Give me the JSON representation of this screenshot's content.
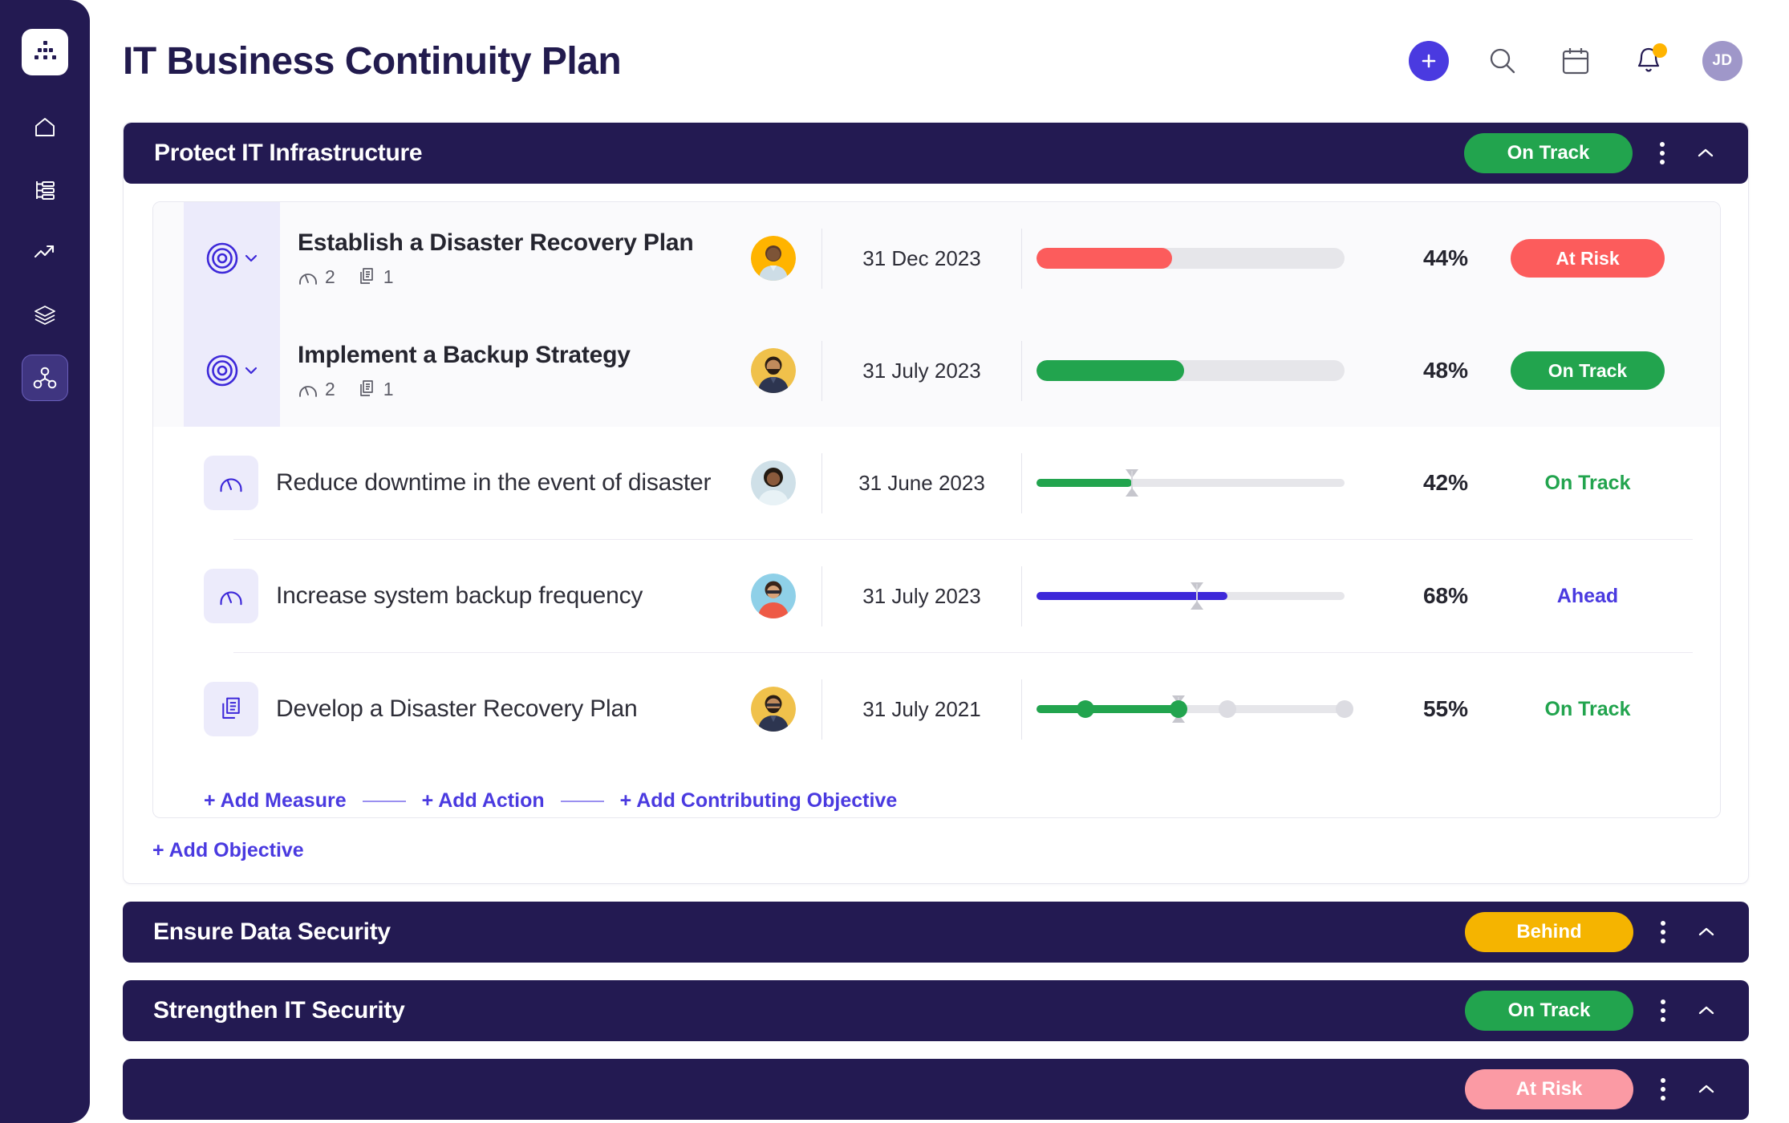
{
  "sidebar": {
    "logo": "org-chart-logo",
    "items": [
      {
        "name": "home",
        "icon": "home-icon",
        "active": false
      },
      {
        "name": "plans",
        "icon": "list-bars-icon",
        "active": false
      },
      {
        "name": "analytics",
        "icon": "trend-up-icon",
        "active": false
      },
      {
        "name": "layers",
        "icon": "layers-icon",
        "active": false
      },
      {
        "name": "strategy-map",
        "icon": "node-network-icon",
        "active": true
      }
    ]
  },
  "header": {
    "title": "IT Business Continuity Plan",
    "actions": [
      {
        "name": "add",
        "icon": "plus-icon"
      },
      {
        "name": "search",
        "icon": "search-icon"
      },
      {
        "name": "calendar",
        "icon": "calendar-icon"
      },
      {
        "name": "notifications",
        "icon": "bell-icon",
        "badge": true
      }
    ],
    "avatar_initials": "JD"
  },
  "colors": {
    "navy": "#231a52",
    "indigo": "#4a3ae0",
    "green": "#22a44e",
    "amber": "#f5b400",
    "red": "#fc5c5c",
    "red_light": "#fb9aa4",
    "track": "#e6e6ea"
  },
  "goals": [
    {
      "title": "Protect IT Infrastructure",
      "status": "On Track",
      "status_color": "green",
      "expanded": true,
      "rows": [
        {
          "type": "objective",
          "icon": "target-icon",
          "name": "Establish a Disaster Recovery Plan",
          "measures_count": "2",
          "actions_count": "1",
          "avatar": "avatar-male-1",
          "date": "31 Dec 2023",
          "bar_type": "thick",
          "progress": 44,
          "percent": "44%",
          "bar_color": "#fc5c5c",
          "status": "At Risk",
          "status_style": "pill-atrisk"
        },
        {
          "type": "objective",
          "icon": "target-icon",
          "name": "Implement a Backup Strategy",
          "measures_count": "2",
          "actions_count": "1",
          "avatar": "avatar-male-2",
          "date": "31 July 2023",
          "bar_type": "thick",
          "progress": 48,
          "percent": "48%",
          "bar_color": "#22a44e",
          "status": "On Track",
          "status_style": "pill-ontrack"
        },
        {
          "type": "measure",
          "icon": "gauge-icon",
          "name": "Reduce downtime in the event of disaster",
          "avatar": "avatar-female-1",
          "date": "31 June 2023",
          "bar_type": "slider",
          "progress": 31,
          "target_marker": 31,
          "percent": "42%",
          "bar_color": "#22a44e",
          "status": "On Track",
          "status_style": "st-ontrack"
        },
        {
          "type": "measure",
          "icon": "gauge-icon",
          "name": "Increase system backup frequency",
          "avatar": "avatar-male-3",
          "date": "31 July 2023",
          "bar_type": "slider",
          "progress": 62,
          "target_marker": 52,
          "percent": "68%",
          "bar_color": "#3d28d9",
          "status": "Ahead",
          "status_style": "st-ahead"
        },
        {
          "type": "action",
          "icon": "document-stack-icon",
          "name": "Develop a Disaster Recovery Plan",
          "avatar": "avatar-male-2",
          "date": "31 July 2021",
          "bar_type": "milestones",
          "progress": 46,
          "target_marker": 46,
          "percent": "55%",
          "bar_color": "#22a44e",
          "milestone_positions": [
            16,
            46,
            62,
            100
          ],
          "milestone_done": [
            true,
            true,
            false,
            false
          ],
          "status": "On Track",
          "status_style": "st-ontrack"
        }
      ],
      "add_links": [
        "+ Add Measure",
        "+ Add Action",
        "+ Add Contributing Objective"
      ],
      "add_objective_label": "+ Add Objective"
    },
    {
      "title": "Ensure Data Security",
      "status": "Behind",
      "status_color": "amber",
      "expanded": false
    },
    {
      "title": "Strengthen IT Security",
      "status": "On Track",
      "status_color": "green",
      "expanded": false
    },
    {
      "title": "",
      "status": "At Risk",
      "status_color": "red_light",
      "expanded": false
    }
  ]
}
